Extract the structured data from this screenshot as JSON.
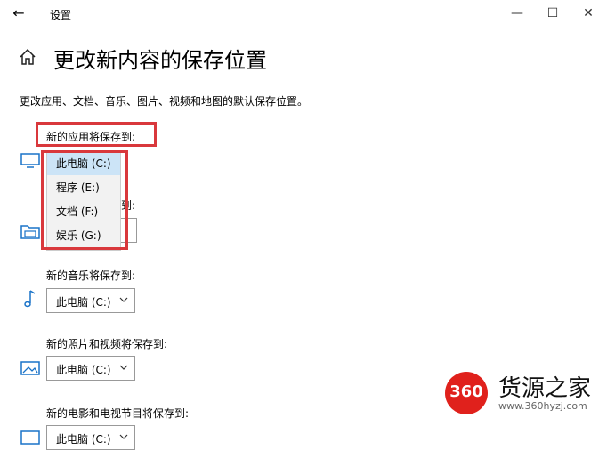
{
  "window": {
    "back_icon": "←",
    "title": "设置",
    "minimize_icon": "—",
    "maximize_icon": "☐",
    "close_icon": "✕"
  },
  "page": {
    "title": "更改新内容的保存位置",
    "description": "更改应用、文档、音乐、图片、视频和地图的默认保存位置。"
  },
  "sections": {
    "apps": {
      "label": "新的应用将保存到:",
      "icon": "monitor-icon"
    },
    "docs": {
      "label_partial": "到:",
      "value_partial": "",
      "icon": "folder-icon"
    },
    "music": {
      "label": "新的音乐将保存到:",
      "value": "此电脑 (C:)",
      "icon": "music-note-icon"
    },
    "photos": {
      "label": "新的照片和视频将保存到:",
      "value": "此电脑 (C:)",
      "icon": "picture-icon"
    },
    "movies": {
      "label": "新的电影和电视节目将保存到:",
      "value": "此电脑 (C:)",
      "icon": "film-icon"
    }
  },
  "dropdown_options": [
    {
      "label": "此电脑 (C:)",
      "selected": true
    },
    {
      "label": "程序 (E:)",
      "selected": false
    },
    {
      "label": "文档 (F:)",
      "selected": false
    },
    {
      "label": "娱乐 (G:)",
      "selected": false
    }
  ],
  "watermark": {
    "logo_text": "360",
    "name": "货源之家",
    "url": "www.360hyzj.com"
  },
  "colors": {
    "highlight_border": "#d9383c",
    "selected_option": "#cce4f7",
    "watermark_red": "#e0211c"
  }
}
